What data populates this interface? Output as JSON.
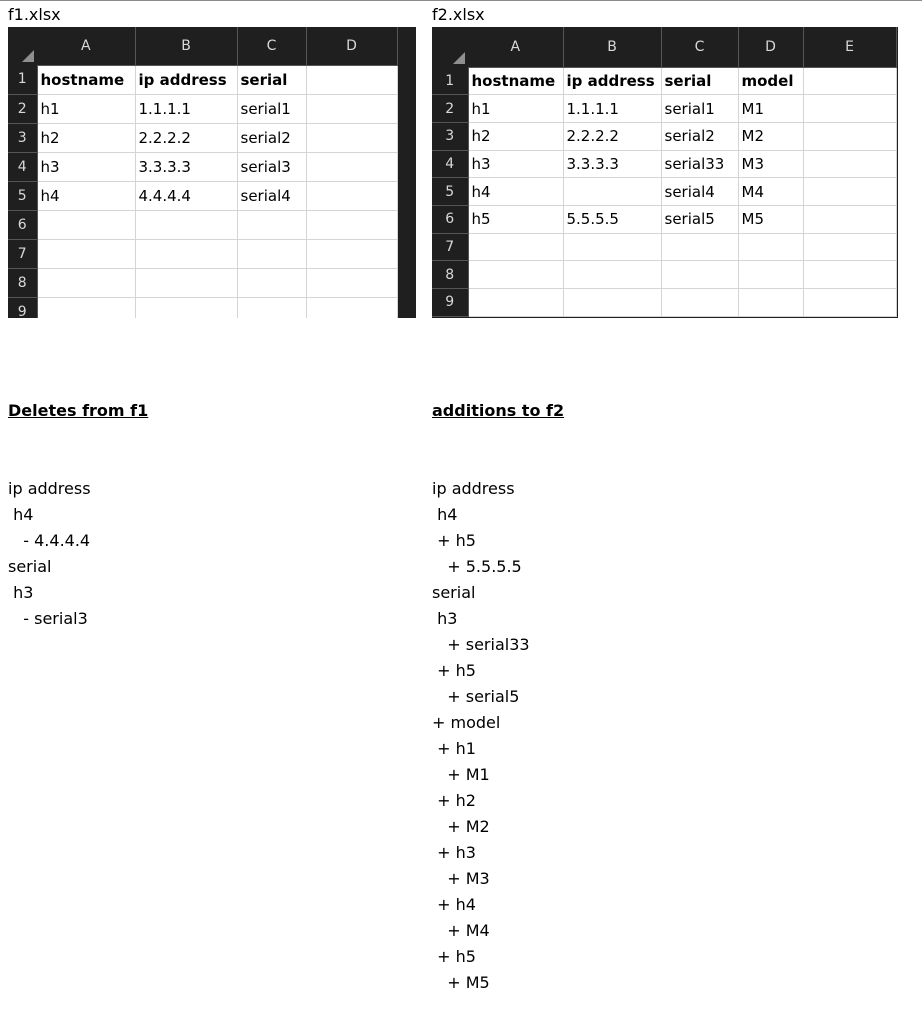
{
  "file1": {
    "title": "f1.xlsx",
    "columns": [
      "A",
      "B",
      "C",
      "D"
    ],
    "rows": [
      {
        "num": "1",
        "cells": [
          "hostname",
          "ip address",
          "serial",
          ""
        ]
      },
      {
        "num": "2",
        "cells": [
          "h1",
          "1.1.1.1",
          "serial1",
          ""
        ]
      },
      {
        "num": "3",
        "cells": [
          "h2",
          "2.2.2.2",
          "serial2",
          ""
        ]
      },
      {
        "num": "4",
        "cells": [
          "h3",
          "3.3.3.3",
          "serial3",
          ""
        ]
      },
      {
        "num": "5",
        "cells": [
          "h4",
          "4.4.4.4",
          "serial4",
          ""
        ]
      },
      {
        "num": "6",
        "cells": [
          "",
          "",
          "",
          ""
        ]
      },
      {
        "num": "7",
        "cells": [
          "",
          "",
          "",
          ""
        ]
      },
      {
        "num": "8",
        "cells": [
          "",
          "",
          "",
          ""
        ]
      },
      {
        "num": "9",
        "cells": [
          "",
          "",
          "",
          ""
        ]
      }
    ]
  },
  "file2": {
    "title": "f2.xlsx",
    "columns": [
      "A",
      "B",
      "C",
      "D",
      "E"
    ],
    "rows": [
      {
        "num": "1",
        "cells": [
          "hostname",
          "ip address",
          "serial",
          "model",
          ""
        ]
      },
      {
        "num": "2",
        "cells": [
          "h1",
          "1.1.1.1",
          "serial1",
          "M1",
          ""
        ]
      },
      {
        "num": "3",
        "cells": [
          "h2",
          "2.2.2.2",
          "serial2",
          "M2",
          ""
        ]
      },
      {
        "num": "4",
        "cells": [
          "h3",
          "3.3.3.3",
          "serial33",
          "M3",
          ""
        ]
      },
      {
        "num": "5",
        "cells": [
          "h4",
          "",
          "serial4",
          "M4",
          ""
        ]
      },
      {
        "num": "6",
        "cells": [
          "h5",
          "5.5.5.5",
          "serial5",
          "M5",
          ""
        ]
      },
      {
        "num": "7",
        "cells": [
          "",
          "",
          "",
          "",
          ""
        ]
      },
      {
        "num": "8",
        "cells": [
          "",
          "",
          "",
          "",
          ""
        ]
      },
      {
        "num": "9",
        "cells": [
          "",
          "",
          "",
          "",
          ""
        ]
      }
    ]
  },
  "deletes": {
    "heading": "Deletes from f1",
    "lines": [
      "ip address",
      " h4",
      "   - 4.4.4.4",
      "serial",
      " h3",
      "   - serial3"
    ]
  },
  "additions": {
    "heading": "additions to f2",
    "lines": [
      "ip address",
      " h4",
      " + h5",
      "   + 5.5.5.5",
      "serial",
      " h3",
      "   + serial33",
      " + h5",
      "   + serial5",
      "+ model",
      " + h1",
      "   + M1",
      " + h2",
      "   + M2",
      " + h3",
      "   + M3",
      " + h4",
      "   + M4",
      " + h5",
      "   + M5"
    ]
  }
}
